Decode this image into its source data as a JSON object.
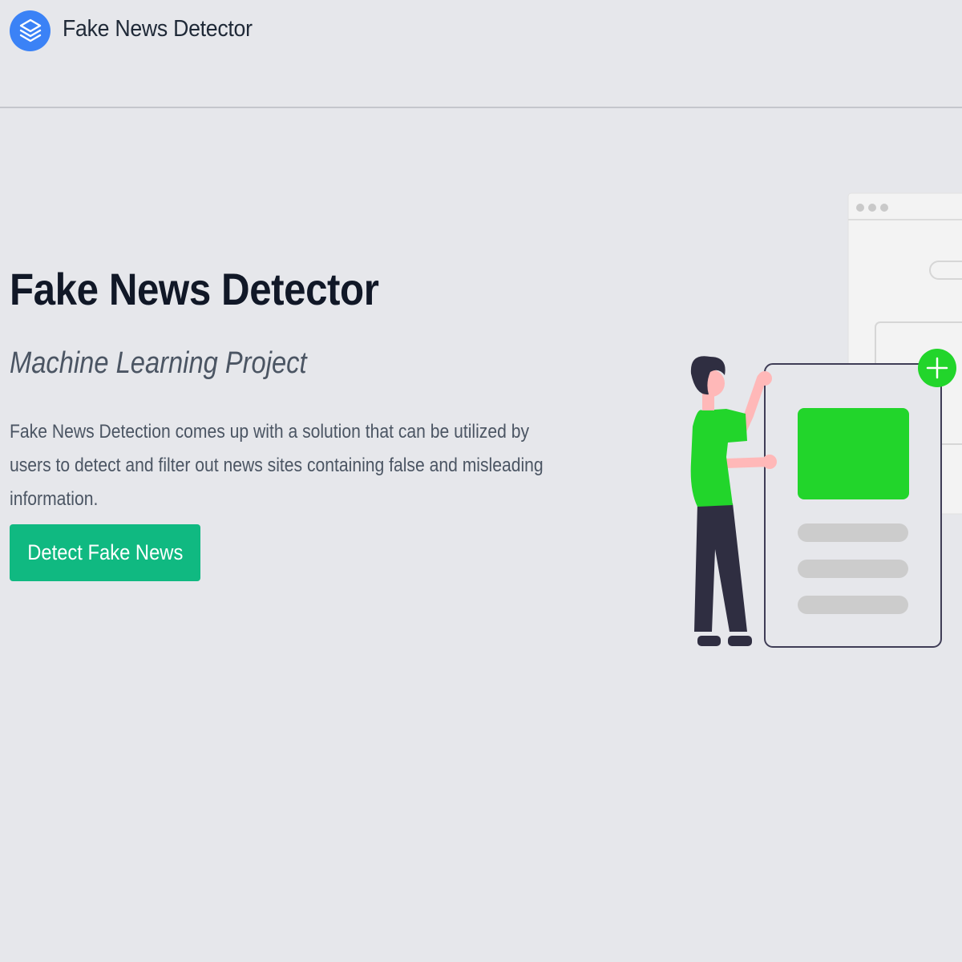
{
  "header": {
    "brand": "Fake News Detector",
    "logo_icon": "layers-icon",
    "logo_color": "#3b82f6"
  },
  "hero": {
    "title": "Fake News Detector",
    "subtitle": "Machine Learning Project",
    "description": "Fake News Detection comes up with a solution that can be utilized by users to detect and filter out news sites containing false and misleading information.",
    "cta_label": "Detect Fake News",
    "cta_color": "#10b981"
  },
  "illustration": {
    "accent_color": "#22d52b",
    "icons": [
      "plus-icon"
    ]
  }
}
